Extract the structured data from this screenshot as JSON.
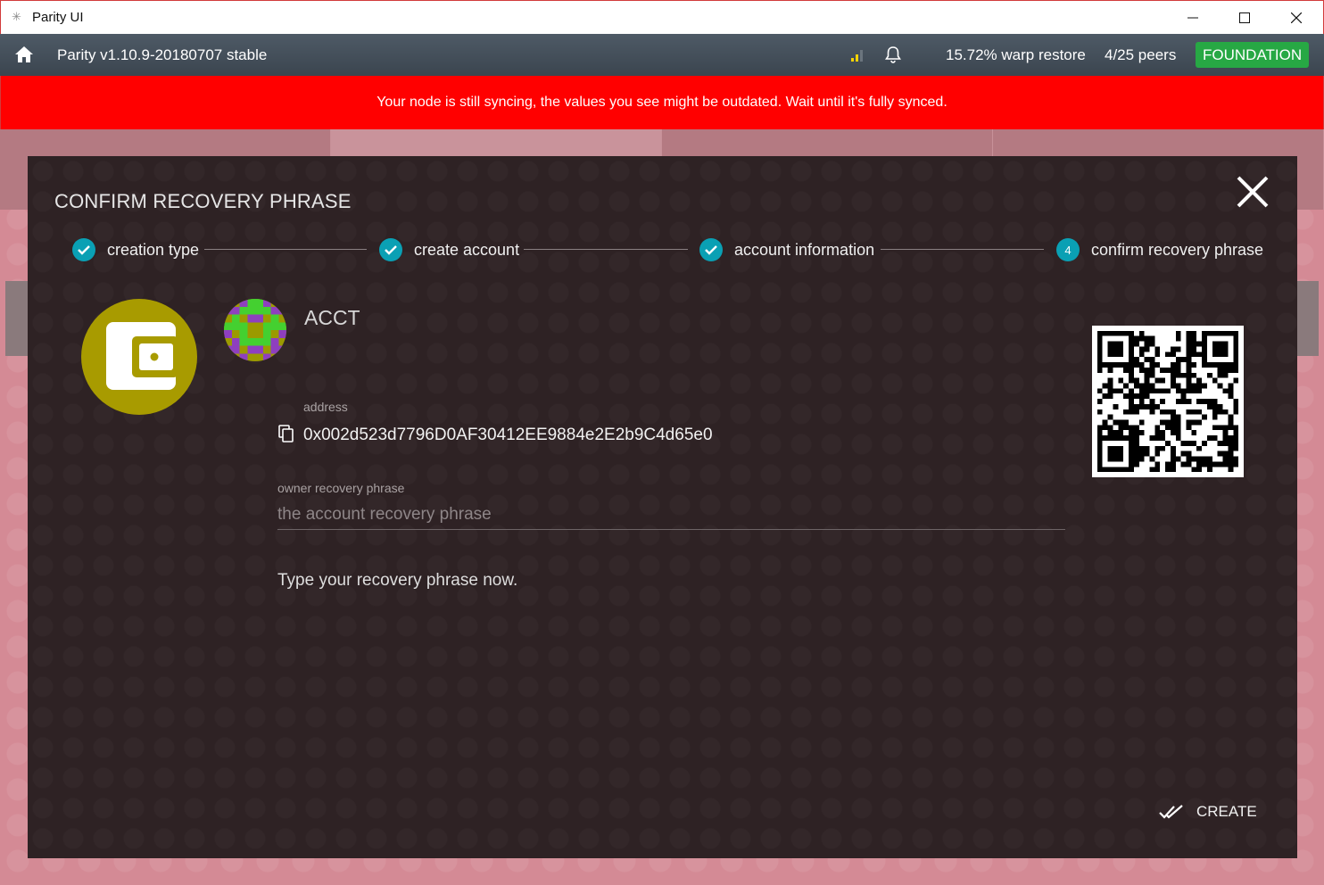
{
  "window": {
    "title": "Parity UI",
    "app_icon": "parity-logo-icon",
    "controls": [
      "minimize-icon",
      "maximize-icon",
      "close-icon"
    ]
  },
  "statusbar": {
    "version": "Parity v1.10.9-20180707 stable",
    "sync_status": "15.72% warp restore",
    "peers": "4/25 peers",
    "chain": "FOUNDATION",
    "chain_color": "#27a844",
    "icons": [
      "home-icon",
      "signal-icon",
      "bell-icon"
    ]
  },
  "warning": {
    "text": "Your node is still syncing, the values you see might be outdated. Wait until it's fully synced.",
    "color": "#ff0000"
  },
  "modal": {
    "title": "CONFIRM RECOVERY PHRASE",
    "steps": [
      {
        "label": "creation type",
        "state": "done"
      },
      {
        "label": "create account",
        "state": "done"
      },
      {
        "label": "account information",
        "state": "done"
      },
      {
        "label": "confirm recovery phrase",
        "state": "active",
        "number": "4"
      }
    ],
    "account": {
      "name": "ACCT",
      "address_label": "address",
      "address": "0x002d523d7796D0AF30412EE9884e2E2b9C4d65e0"
    },
    "recovery": {
      "label": "owner recovery phrase",
      "placeholder": "the account recovery phrase",
      "value": "",
      "hint": "Type your recovery phrase now."
    },
    "create_label": "CREATE",
    "accent_color": "#0aa0b4",
    "wallet_color": "#a89b00"
  }
}
